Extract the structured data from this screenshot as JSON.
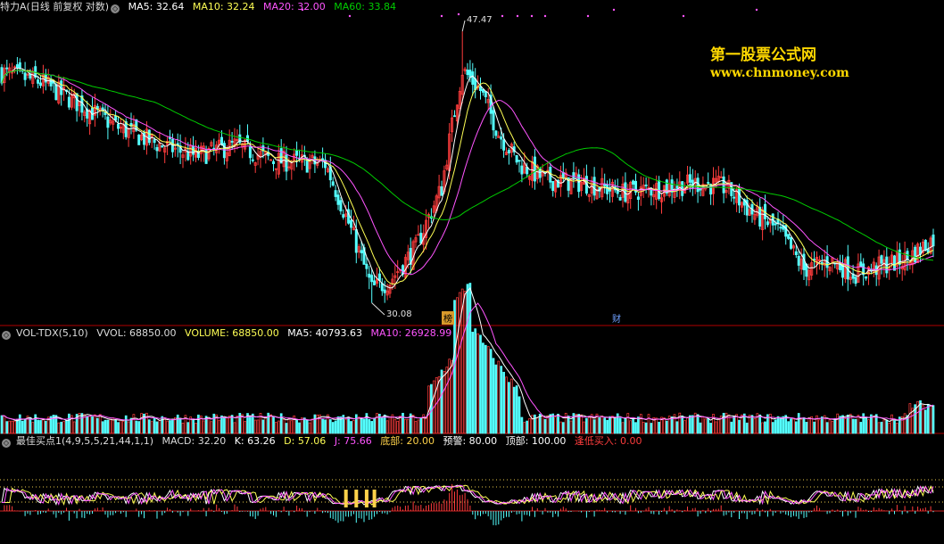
{
  "header_price": {
    "title": "特力A(日线 前复权 对数)",
    "ma5": "MA5: 32.64",
    "ma10": "MA10: 32.24",
    "ma20": "MA20: 32.00",
    "ma60": "MA60: 33.84"
  },
  "header_volume": {
    "name": "VOL-TDX(5,10)",
    "vvol": "VVOL: 68850.00",
    "volume": "VOLUME: 68850.00",
    "ma5": "MA5: 40793.63",
    "ma10": "MA10: 26928.99"
  },
  "header_indicator": {
    "name": "最佳买点1(4,9,5,5,21,44,1,1)",
    "macd": "MACD: 32.20",
    "k": "K: 63.26",
    "d": "D: 57.06",
    "j": "J: 75.66",
    "bottom": "底部: 20.00",
    "warning": "预警: 80.00",
    "top": "顶部: 100.00",
    "buy": "逢低买入: 0.00"
  },
  "watermark": {
    "line1": "第一股票公式网",
    "line2": "www.chnmoney.com"
  },
  "annotations": {
    "high": "47.47",
    "low": "30.08",
    "tag_bang": "榜",
    "tag_cai": "财"
  },
  "colors": {
    "background": "#000000",
    "up": "#ff3d3d",
    "down": "#54ffff",
    "ma5": "#ffffff",
    "ma10": "#ffff55",
    "ma20": "#ff55ff",
    "ma60": "#00cc00",
    "panel_border": "#b00000",
    "watermark": "#ffd800"
  },
  "chart_data": {
    "type": "candlestick",
    "title": "特力A(日线 前复权 对数)",
    "price_range": [
      29.0,
      49.0
    ],
    "highest": 47.47,
    "lowest": 30.08,
    "last_close_estimate": 33.5,
    "series_latest": [
      {
        "name": "MA5",
        "value": 32.64
      },
      {
        "name": "MA10",
        "value": 32.24
      },
      {
        "name": "MA20",
        "value": 32.0
      },
      {
        "name": "MA60",
        "value": 33.84
      }
    ],
    "close_path": [
      {
        "bar": 0,
        "close": 44.3
      },
      {
        "bar": 15,
        "close": 43.6
      },
      {
        "bar": 30,
        "close": 42.0
      },
      {
        "bar": 45,
        "close": 40.4
      },
      {
        "bar": 60,
        "close": 39.3
      },
      {
        "bar": 75,
        "close": 38.5
      },
      {
        "bar": 90,
        "close": 39.2
      },
      {
        "bar": 105,
        "close": 38.2
      },
      {
        "bar": 125,
        "close": 38.0
      },
      {
        "bar": 135,
        "close": 34.0
      },
      {
        "bar": 143,
        "close": 30.8
      },
      {
        "bar": 150,
        "close": 31.2
      },
      {
        "bar": 160,
        "close": 33.0
      },
      {
        "bar": 170,
        "close": 36.5
      },
      {
        "bar": 178,
        "close": 44.5
      },
      {
        "bar": 185,
        "close": 43.0
      },
      {
        "bar": 192,
        "close": 40.0
      },
      {
        "bar": 200,
        "close": 38.0
      },
      {
        "bar": 210,
        "close": 37.0
      },
      {
        "bar": 225,
        "close": 36.8
      },
      {
        "bar": 240,
        "close": 36.2
      },
      {
        "bar": 255,
        "close": 36.5
      },
      {
        "bar": 270,
        "close": 36.8
      },
      {
        "bar": 280,
        "close": 36.5
      },
      {
        "bar": 290,
        "close": 35.0
      },
      {
        "bar": 300,
        "close": 34.0
      },
      {
        "bar": 310,
        "close": 31.8
      },
      {
        "bar": 320,
        "close": 32.3
      },
      {
        "bar": 330,
        "close": 31.6
      },
      {
        "bar": 340,
        "close": 32.0
      },
      {
        "bar": 350,
        "close": 32.4
      },
      {
        "bar": 360,
        "close": 33.5
      }
    ],
    "volume_latest": {
      "vvol": 68850.0,
      "volume": 68850.0,
      "ma5": 40793.63,
      "ma10": 26928.99
    },
    "indicator_latest": {
      "macd": 32.2,
      "k": 63.26,
      "d": 57.06,
      "j": 75.66,
      "bottom": 20.0,
      "warning": 80.0,
      "top": 100.0,
      "buy": 0.0
    }
  }
}
